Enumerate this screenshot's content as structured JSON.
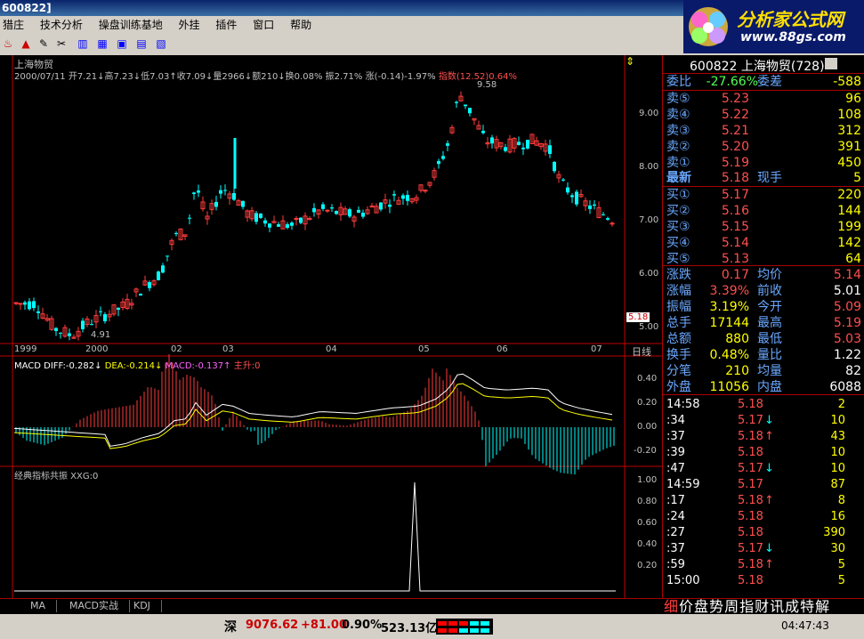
{
  "window": {
    "title": "600822]"
  },
  "menu": [
    "猎庄",
    "技术分析",
    "操盘训练基地",
    "外挂",
    "插件",
    "窗口",
    "帮助"
  ],
  "logo": {
    "text": "分析家公式网",
    "url": "www.88gs.com"
  },
  "chart": {
    "stock_name": "上海物贸",
    "info_line": "2000/07/11 开7.21↓高7.23↓低7.03↑收7.09↓量2966↓额210↓换0.08% 振2.71% 涨(-0.14)-1.97%",
    "index_line": "指数(12.52)0.64%",
    "high_label": "9.58",
    "low_label": "4.91",
    "current_price_label": "5.18",
    "period_label": "日线",
    "x_labels": [
      "1999",
      "2000",
      "02",
      "03",
      "04",
      "05",
      "06",
      "07"
    ],
    "price_ticks": [
      "9.00",
      "8.00",
      "7.00",
      "6.00",
      "5.00"
    ],
    "macd_header": {
      "diff": "MACD DIFF:-0.282↓",
      "dea": "DEA:-0.214↓",
      "macd": "MACD:-0.137↑",
      "signal": "主升:0"
    },
    "macd_ticks": [
      "0.40",
      "0.20",
      "0.00",
      "-0.20"
    ],
    "xxg_header": "经典指标共振 XXG:0",
    "xxg_ticks": [
      "1.00",
      "0.80",
      "0.60",
      "0.40",
      "0.20"
    ]
  },
  "quote": {
    "code": "600822",
    "name": "上海物贸",
    "rank": "(728)",
    "weibi_label": "委比",
    "weibi": "-27.66%",
    "weicha_label": "委差",
    "weicha": "-588",
    "asks": [
      {
        "label": "卖⑤",
        "price": "5.23",
        "vol": "96"
      },
      {
        "label": "卖④",
        "price": "5.22",
        "vol": "108"
      },
      {
        "label": "卖③",
        "price": "5.21",
        "vol": "312"
      },
      {
        "label": "卖②",
        "price": "5.20",
        "vol": "391"
      },
      {
        "label": "卖①",
        "price": "5.19",
        "vol": "450"
      }
    ],
    "last_label": "最新",
    "last": "5.18",
    "xianshou_label": "现手",
    "xianshou": "5",
    "bids": [
      {
        "label": "买①",
        "price": "5.17",
        "vol": "220"
      },
      {
        "label": "买②",
        "price": "5.16",
        "vol": "144"
      },
      {
        "label": "买③",
        "price": "5.15",
        "vol": "199"
      },
      {
        "label": "买④",
        "price": "5.14",
        "vol": "142"
      },
      {
        "label": "买⑤",
        "price": "5.13",
        "vol": "64"
      }
    ],
    "stats": [
      {
        "l1": "涨跌",
        "v1": "0.17",
        "l2": "均价",
        "v2": "5.14"
      },
      {
        "l1": "涨幅",
        "v1": "3.39%",
        "l2": "前收",
        "v2": "5.01"
      },
      {
        "l1": "振幅",
        "v1": "3.19%",
        "l2": "今开",
        "v2": "5.09"
      },
      {
        "l1": "总手",
        "v1": "17144",
        "l2": "最高",
        "v2": "5.19"
      },
      {
        "l1": "总额",
        "v1": "880",
        "l2": "最低",
        "v2": "5.03"
      },
      {
        "l1": "换手",
        "v1": "0.48%",
        "l2": "量比",
        "v2": "1.22"
      },
      {
        "l1": "分笔",
        "v1": "210",
        "l2": "均量",
        "v2": "82"
      },
      {
        "l1": "外盘",
        "v1": "11056",
        "l2": "内盘",
        "v2": "6088"
      }
    ],
    "ticks": [
      {
        "t": "14:58",
        "p": "5.18",
        "a": "",
        "q": "2"
      },
      {
        "t": ":34",
        "p": "5.17",
        "a": "↓",
        "q": "10"
      },
      {
        "t": ":37",
        "p": "5.18",
        "a": "↑",
        "q": "43"
      },
      {
        "t": ":39",
        "p": "5.18",
        "a": "",
        "q": "10"
      },
      {
        "t": ":47",
        "p": "5.17",
        "a": "↓",
        "q": "10"
      },
      {
        "t": "14:59",
        "p": "5.17",
        "a": "",
        "q": "87"
      },
      {
        "t": ":17",
        "p": "5.18",
        "a": "↑",
        "q": "8"
      },
      {
        "t": ":24",
        "p": "5.18",
        "a": "",
        "q": "16"
      },
      {
        "t": ":27",
        "p": "5.18",
        "a": "",
        "q": "390"
      },
      {
        "t": ":37",
        "p": "5.17",
        "a": "↓",
        "q": "30"
      },
      {
        "t": ":59",
        "p": "5.18",
        "a": "↑",
        "q": "5"
      },
      {
        "t": "15:00",
        "p": "5.18",
        "a": "",
        "q": "5"
      }
    ],
    "bottom_tabs": [
      "细",
      "价",
      "盘",
      "势",
      "周",
      "指",
      "财",
      "讯",
      "成",
      "特",
      "解"
    ]
  },
  "indicator_tabs": [
    "MA",
    "MACD实战",
    "KDJ"
  ],
  "status": {
    "market": "深",
    "index": "9076.62",
    "change": "+81.00",
    "pct": "0.90%",
    "amount": "523.13亿",
    "time": "04:47:43"
  },
  "colors": {
    "up": "#ff3c3c",
    "down": "#00ffff",
    "axis": "#c00000"
  }
}
